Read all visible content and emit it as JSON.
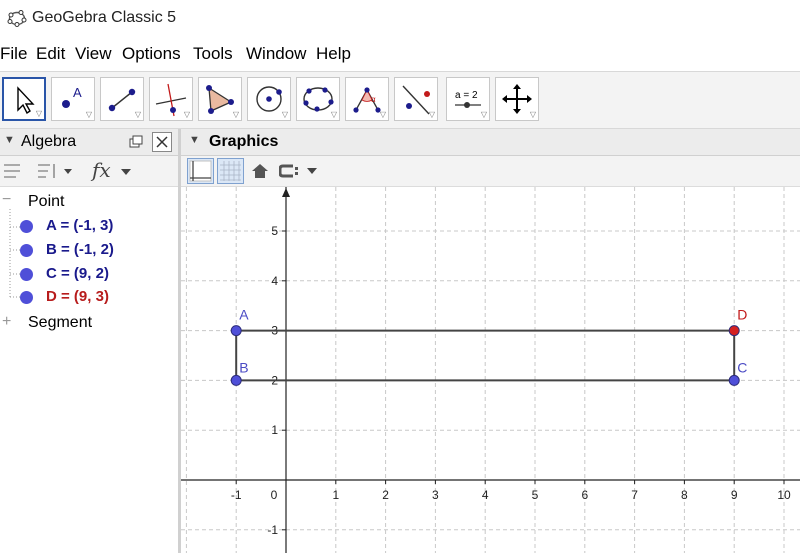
{
  "window": {
    "title": "GeoGebra Classic 5"
  },
  "menu": [
    "File",
    "Edit",
    "View",
    "Options",
    "Tools",
    "Window",
    "Help"
  ],
  "toolbar": {
    "tools": [
      "move",
      "point",
      "segment",
      "perpendicular-line",
      "polygon",
      "circle-center-point",
      "conic-five-points",
      "angle",
      "reflect",
      "slider",
      "move-graphics-view"
    ],
    "slider_label": "a = 2"
  },
  "algebra": {
    "title": "Algebra",
    "groups": [
      {
        "label": "Point",
        "expanded": true,
        "items": [
          {
            "text": "A = (-1, 3)",
            "color": "#1a1a8c",
            "dot": "#4f4fd8"
          },
          {
            "text": "B = (-1, 2)",
            "color": "#1a1a8c",
            "dot": "#4f4fd8"
          },
          {
            "text": "C = (9, 2)",
            "color": "#1a1a8c",
            "dot": "#4f4fd8"
          },
          {
            "text": "D = (9, 3)",
            "color": "#b71c1c",
            "dot": "#4f4fd8"
          }
        ]
      },
      {
        "label": "Segment",
        "expanded": false,
        "items": []
      }
    ]
  },
  "graphics": {
    "title": "Graphics",
    "x_ticks": [
      "-1",
      "0",
      "1",
      "2",
      "3",
      "4",
      "5",
      "6",
      "7",
      "8",
      "9",
      "10"
    ],
    "y_ticks": [
      "5",
      "4",
      "3",
      "2",
      "1",
      "-1"
    ],
    "points": [
      {
        "name": "A",
        "x": -1,
        "y": 3,
        "color": "#4f4fd8",
        "label_color": "#4b4bc4"
      },
      {
        "name": "B",
        "x": -1,
        "y": 2,
        "color": "#4f4fd8",
        "label_color": "#4b4bc4"
      },
      {
        "name": "C",
        "x": 9,
        "y": 2,
        "color": "#4f4fd8",
        "label_color": "#4b4bc4"
      },
      {
        "name": "D",
        "x": 9,
        "y": 3,
        "color": "#d42020",
        "label_color": "#c21a1a"
      }
    ],
    "segments": [
      [
        "A",
        "B"
      ],
      [
        "A",
        "D"
      ],
      [
        "B",
        "C"
      ],
      [
        "C",
        "D"
      ]
    ]
  }
}
